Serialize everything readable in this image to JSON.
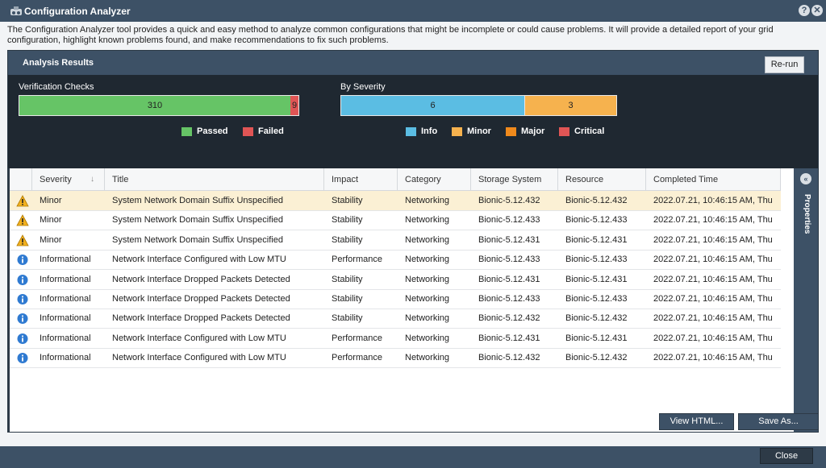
{
  "window": {
    "title": "Configuration Analyzer",
    "help_glyph": "?",
    "close_glyph": "✕"
  },
  "description": "The Configuration Analyzer tool provides a quick and easy method to analyze common configurations that might be incomplete or could cause problems. It will provide a detailed report of your grid configuration, highlight known problems found, and make recommendations to fix such problems.",
  "panel": {
    "title": "Analysis Results",
    "rerun_label": "Re-run"
  },
  "verification": {
    "label": "Verification Checks",
    "passed_value": "310",
    "failed_value": "9",
    "passed_count": 310,
    "failed_count": 9,
    "legend": [
      {
        "label": "Passed",
        "color": "#66c466"
      },
      {
        "label": "Failed",
        "color": "#e05555"
      }
    ]
  },
  "severity": {
    "label": "By Severity",
    "info_value": "6",
    "minor_value": "3",
    "info_count": 6,
    "minor_count": 3,
    "legend": [
      {
        "label": "Info",
        "color": "#5bbde3"
      },
      {
        "label": "Minor",
        "color": "#f6b24e"
      },
      {
        "label": "Major",
        "color": "#f08a1c"
      },
      {
        "label": "Critical",
        "color": "#e05555"
      }
    ]
  },
  "table": {
    "columns": [
      "Severity",
      "Title",
      "Impact",
      "Category",
      "Storage System",
      "Resource",
      "Completed Time"
    ],
    "rows": [
      {
        "icon": "warning",
        "severity": "Minor",
        "title": "System Network Domain Suffix Unspecified",
        "impact": "Stability",
        "category": "Networking",
        "storage": "Bionic-5.12.432",
        "resource": "Bionic-5.12.432",
        "time": "2022.07.21, 10:46:15 AM, Thu"
      },
      {
        "icon": "warning",
        "severity": "Minor",
        "title": "System Network Domain Suffix Unspecified",
        "impact": "Stability",
        "category": "Networking",
        "storage": "Bionic-5.12.433",
        "resource": "Bionic-5.12.433",
        "time": "2022.07.21, 10:46:15 AM, Thu"
      },
      {
        "icon": "warning",
        "severity": "Minor",
        "title": "System Network Domain Suffix Unspecified",
        "impact": "Stability",
        "category": "Networking",
        "storage": "Bionic-5.12.431",
        "resource": "Bionic-5.12.431",
        "time": "2022.07.21, 10:46:15 AM, Thu"
      },
      {
        "icon": "info",
        "severity": "Informational",
        "title": "Network Interface Configured with Low MTU",
        "impact": "Performance",
        "category": "Networking",
        "storage": "Bionic-5.12.433",
        "resource": "Bionic-5.12.433",
        "time": "2022.07.21, 10:46:15 AM, Thu"
      },
      {
        "icon": "info",
        "severity": "Informational",
        "title": "Network Interface Dropped Packets Detected",
        "impact": "Stability",
        "category": "Networking",
        "storage": "Bionic-5.12.431",
        "resource": "Bionic-5.12.431",
        "time": "2022.07.21, 10:46:15 AM, Thu"
      },
      {
        "icon": "info",
        "severity": "Informational",
        "title": "Network Interface Dropped Packets Detected",
        "impact": "Stability",
        "category": "Networking",
        "storage": "Bionic-5.12.433",
        "resource": "Bionic-5.12.433",
        "time": "2022.07.21, 10:46:15 AM, Thu"
      },
      {
        "icon": "info",
        "severity": "Informational",
        "title": "Network Interface Dropped Packets Detected",
        "impact": "Stability",
        "category": "Networking",
        "storage": "Bionic-5.12.432",
        "resource": "Bionic-5.12.432",
        "time": "2022.07.21, 10:46:15 AM, Thu"
      },
      {
        "icon": "info",
        "severity": "Informational",
        "title": "Network Interface Configured with Low MTU",
        "impact": "Performance",
        "category": "Networking",
        "storage": "Bionic-5.12.431",
        "resource": "Bionic-5.12.431",
        "time": "2022.07.21, 10:46:15 AM, Thu"
      },
      {
        "icon": "info",
        "severity": "Informational",
        "title": "Network Interface Configured with Low MTU",
        "impact": "Performance",
        "category": "Networking",
        "storage": "Bionic-5.12.432",
        "resource": "Bionic-5.12.432",
        "time": "2022.07.21, 10:46:15 AM, Thu"
      }
    ],
    "selected_row": 0
  },
  "side_panel": {
    "label": "Properties"
  },
  "buttons": {
    "view_html": "View HTML...",
    "save_as": "Save As...",
    "close": "Close"
  },
  "colors": {
    "chrome": "#3d5166",
    "panel_dark": "#1f2831",
    "selected_row": "#fbf0d4"
  }
}
